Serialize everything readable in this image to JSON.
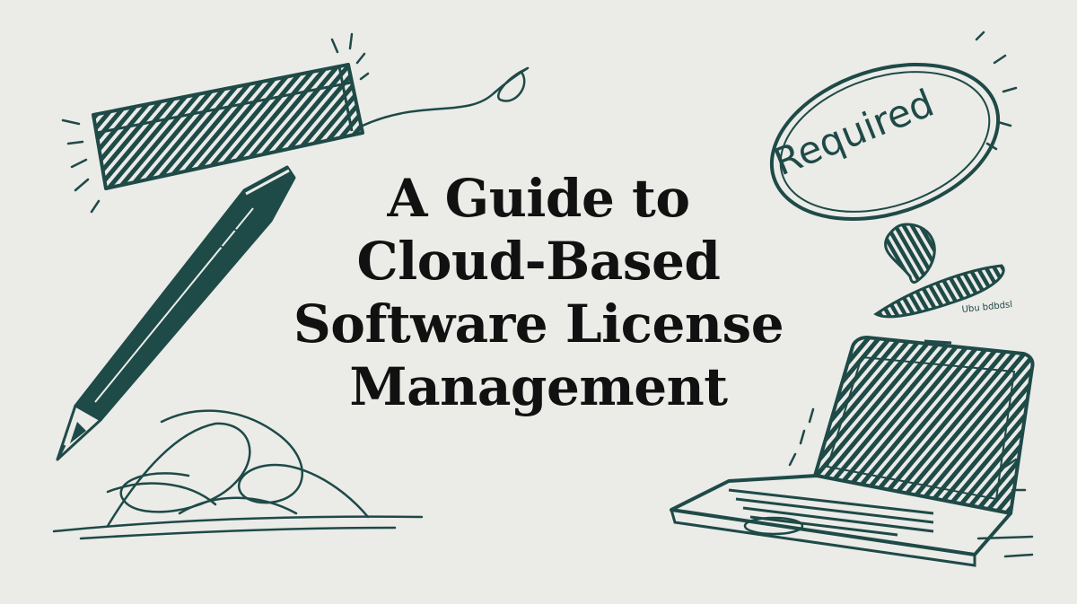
{
  "title": {
    "lines": [
      "A Guide to",
      "Cloud-Based",
      "Software License",
      "Management"
    ]
  },
  "stamp": {
    "label": "Required"
  },
  "scribble_text": "Ubu bdbdsl",
  "colors": {
    "background": "#ebebe8",
    "ink": "#1e4a47",
    "title": "#111111"
  },
  "icons": [
    "highlighter-icon",
    "pencil-icon",
    "required-stamp-icon",
    "laptop-icon"
  ]
}
